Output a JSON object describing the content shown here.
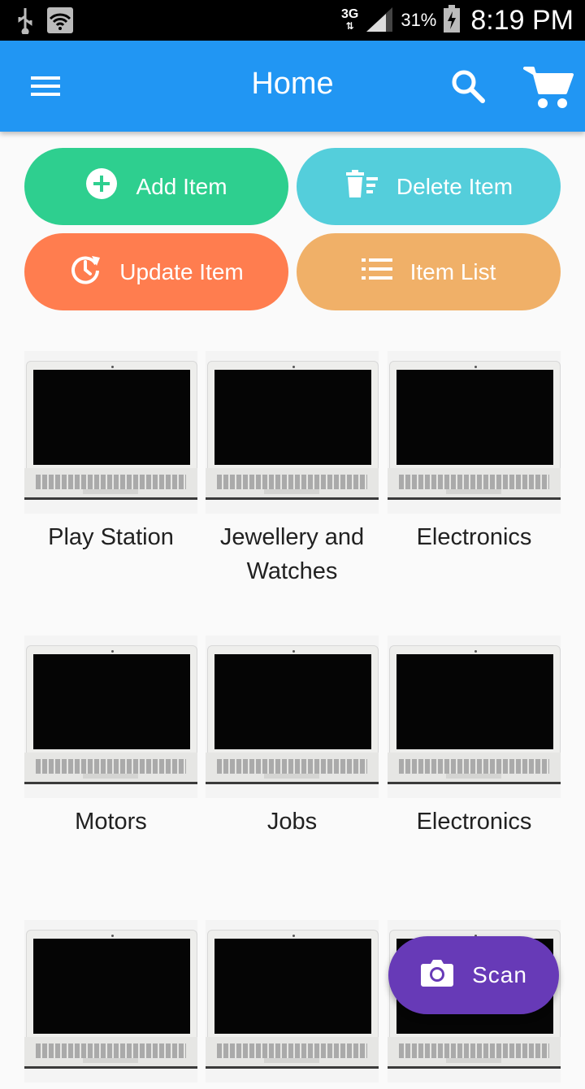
{
  "status_bar": {
    "network": "3G",
    "battery_percent": "31%",
    "time": "8:19 PM",
    "icons": [
      "usb-icon",
      "wifi-icon",
      "signal-icon",
      "battery-charging-icon"
    ]
  },
  "app_bar": {
    "title": "Home",
    "color": "#2196f3",
    "icons": [
      "menu-icon",
      "search-icon",
      "cart-icon"
    ]
  },
  "actions": {
    "add": {
      "label": "Add Item",
      "icon": "add-circle-icon",
      "color": "#2ecf8f"
    },
    "delete": {
      "label": "Delete Item",
      "icon": "delete-list-icon",
      "color": "#54cedb"
    },
    "update": {
      "label": "Update Item",
      "icon": "update-icon",
      "color": "#ff7d4f"
    },
    "list": {
      "label": "Item List",
      "icon": "list-icon",
      "color": "#f0b068"
    }
  },
  "categories": [
    {
      "label": "Play Station"
    },
    {
      "label": "Jewellery and Watches"
    },
    {
      "label": "Electronics"
    },
    {
      "label": "Motors"
    },
    {
      "label": "Jobs"
    },
    {
      "label": "Electronics"
    },
    {
      "label": ""
    },
    {
      "label": ""
    },
    {
      "label": ""
    }
  ],
  "fab": {
    "label": "Scan",
    "icon": "camera-icon",
    "color": "#673ab7"
  }
}
